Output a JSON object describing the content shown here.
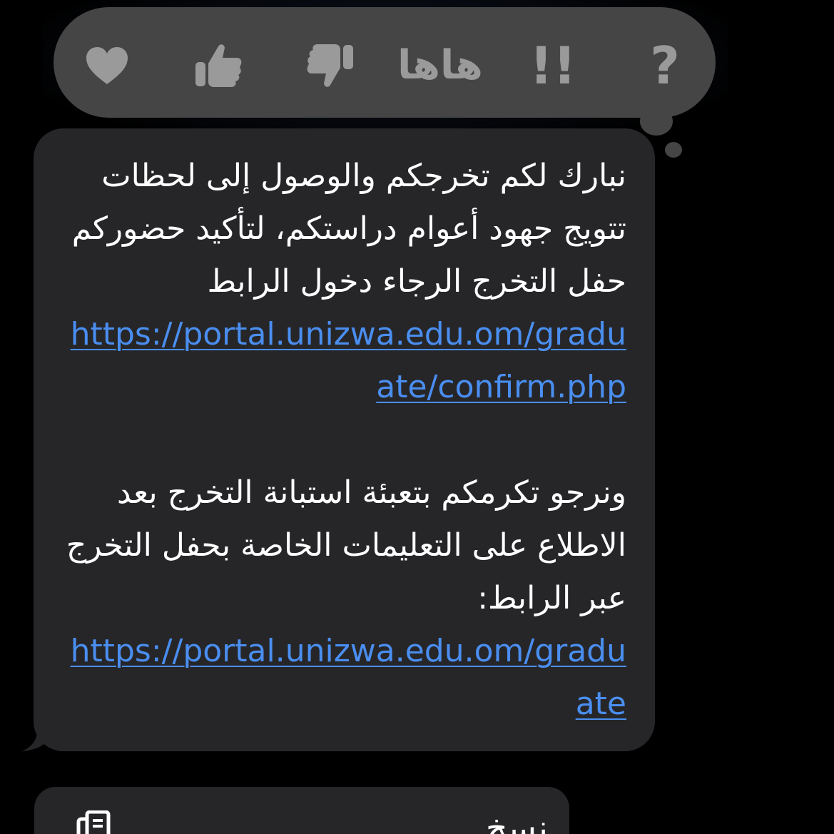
{
  "reactions": [
    {
      "name": "heart",
      "icon": "heart-icon"
    },
    {
      "name": "like",
      "icon": "thumbs-up-icon"
    },
    {
      "name": "dislike",
      "icon": "thumbs-down-icon"
    },
    {
      "name": "haha",
      "label": "هاها"
    },
    {
      "name": "emphasize",
      "label": "!!"
    },
    {
      "name": "question",
      "label": "?"
    }
  ],
  "message": {
    "paragraph1_text": "نبارك لكم تخرجكم والوصول إلى لحظات تتويج جهود أعوام دراستكم، لتأكيد حضوركم حفل التخرج الرجاء دخول الرابط ",
    "link1": "https://portal.unizwa.edu.om/graduate/confirm.php",
    "paragraph2_text": "ونرجو تكرمكم بتعبئة استبانة التخرج بعد الاطلاع على التعليمات الخاصة بحفل التخرج عبر الرابط: ",
    "link2": "https://portal.unizwa.edu.om/graduate"
  },
  "menu": {
    "copy_label": "نسخ"
  },
  "colors": {
    "background": "#000000",
    "bubble": "#262629",
    "tapback": "#454546",
    "reaction_icon": "#9a9a9b",
    "link": "#4a8ef0",
    "text": "#ffffff"
  }
}
